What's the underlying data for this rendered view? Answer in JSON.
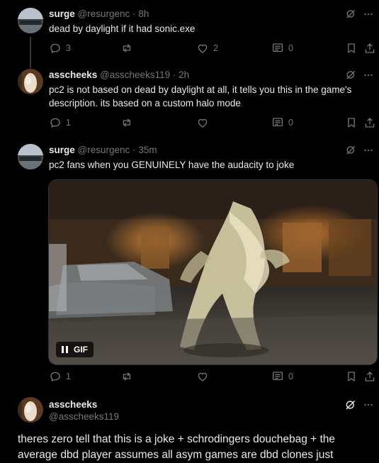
{
  "tweets": [
    {
      "name": "surge",
      "handle": "@resurgenc",
      "separator": "·",
      "time": "8h",
      "text": "dead by daylight if it had sonic.exe",
      "reply_count": "3",
      "retweet_count": "",
      "like_count": "2",
      "views_count": "0",
      "avatar_icon": "surge-avatar"
    },
    {
      "name": "asscheeks",
      "handle": "@asscheeks119",
      "separator": "·",
      "time": "2h",
      "text": "pc2 is not based on dead by daylight at all, it tells you this in the game's description. its based on a custom halo mode",
      "reply_count": "1",
      "retweet_count": "",
      "like_count": "",
      "views_count": "0",
      "avatar_icon": "asscheeks-avatar"
    },
    {
      "name": "surge",
      "handle": "@resurgenc",
      "separator": "·",
      "time": "35m",
      "text": "pc2 fans when you GENUINELY have the audacity to joke",
      "gif_label": "GIF",
      "reply_count": "1",
      "retweet_count": "",
      "like_count": "",
      "views_count": "0",
      "avatar_icon": "surge-avatar"
    },
    {
      "name": "asscheeks",
      "handle": "@asscheeks119",
      "text": "theres zero tell that this is a joke + schrodingers douchebag + the average dbd player assumes all asym games are dbd clones just",
      "avatar_icon": "asscheeks-avatar"
    }
  ],
  "colors": {
    "background": "#000000",
    "text": "#e7e9ea",
    "muted": "#71767b",
    "line": "#333639"
  },
  "icons": {
    "grok": "grok-slash-icon",
    "more": "more-dots-icon",
    "reply": "reply-bubble-icon",
    "retweet": "retweet-icon",
    "like": "heart-icon",
    "views": "views-chart-icon",
    "bookmark": "bookmark-icon",
    "share": "share-icon"
  }
}
